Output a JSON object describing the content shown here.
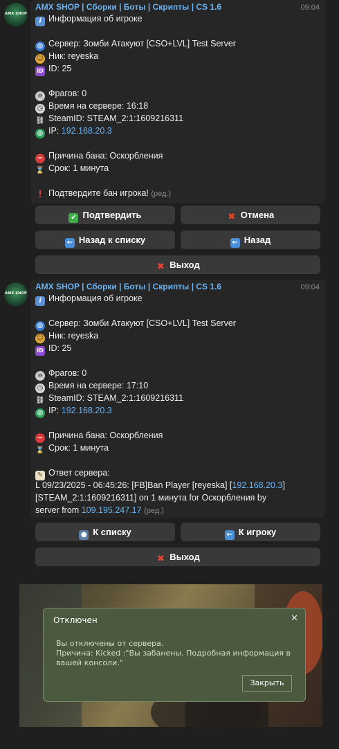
{
  "chat": {
    "sender": "AMX SHOP | Сборки | Боты | Скрипты | CS 1.6",
    "avatar_text": "AMX SHOP",
    "messages": [
      {
        "time": "09:04",
        "title": "Информация об игроке",
        "server": "Сервер: Зомби Атакуют [CSO+LVL] Test Server",
        "nick": "Ник: reyeska",
        "id": "ID: 25",
        "frags": "Фрагов: 0",
        "time_on_server": "Время на сервере: 16:18",
        "steamid": "SteamID: STEAM_2:1:1609216311",
        "ip_label": "IP: ",
        "ip": "192.168.20.3",
        "reason": "Причина бана: Оскорбления",
        "term": "Срок: 1 минута",
        "confirm": "Подтвердите бан игрока!",
        "edited": "(ред.)",
        "buttons": {
          "confirm": "Подтвердить",
          "cancel": "Отмена",
          "back_to_list": "Назад к списку",
          "back": "Назад",
          "exit": "Выход"
        }
      },
      {
        "time": "09:04",
        "title": "Информация об игроке",
        "server": "Сервер: Зомби Атакуют [CSO+LVL] Test Server",
        "nick": "Ник: reyeska",
        "id": "ID: 25",
        "frags": "Фрагов: 0",
        "time_on_server": "Время на сервере: 17:10",
        "steamid": "SteamID: STEAM_2:1:1609216311",
        "ip_label": "IP: ",
        "ip": "192.168.20.3",
        "reason": "Причина бана: Оскорбления",
        "term": "Срок: 1 минута",
        "response_label": "Ответ сервера:",
        "response_line1_a": "L 09/23/2025 - 06:45:26: [FB]Ban Player [reyeska] [",
        "response_line1_ip": "192.168.20.3",
        "response_line1_b": "]",
        "response_line2": "[STEAM_2:1:1609216311] on 1 минута for Оскорбления by",
        "response_line3_a": "server from ",
        "response_line3_ip": "109.195.247.17",
        "edited": "(ред.)",
        "buttons": {
          "to_list": "К списку",
          "to_player": "К игроку",
          "exit": "Выход"
        }
      }
    ]
  },
  "game_dialog": {
    "title": "Отключен",
    "close": "✕",
    "line1": "Вы отключены от сервера.",
    "line2": "Причина: Kicked :\"Вы забанены. Подробная информация в",
    "line3": "вашей консоли.\"",
    "close_button": "Закрыть"
  }
}
